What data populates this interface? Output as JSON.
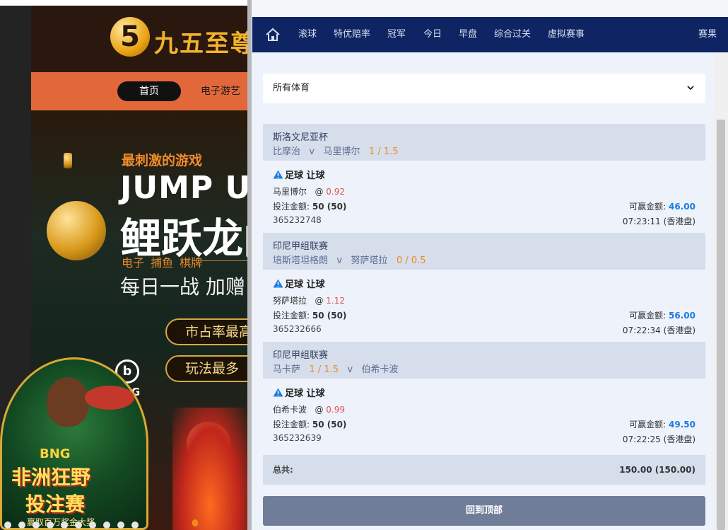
{
  "promo_site": {
    "logo_text": "九五至尊",
    "nav": {
      "home": "首页",
      "games": "电子游艺"
    },
    "banner": {
      "tagline": "最刺激的游戏",
      "headline": "JUMP UP",
      "title": "鲤跃龙门",
      "categories": "电子 捕鱼 棋牌",
      "daily": "每日一战 加赠",
      "pill_1": "市占率最高",
      "pill_2": "玩法最多",
      "brand": "BNG"
    },
    "promo": {
      "brand": "BNG",
      "title_line1": "非洲狂野",
      "title_line2": "投注赛",
      "footer": "赢取百万奖金大奖"
    }
  },
  "betting_panel": {
    "nav": {
      "items": [
        "滚球",
        "特优赔率",
        "冠军",
        "今日",
        "早盘",
        "综合过关",
        "虚拟赛事"
      ],
      "right": "赛果"
    },
    "sport_filter": {
      "label": "所有体育"
    },
    "bets": [
      {
        "league": "斯洛文尼亚杯",
        "home": "比摩治",
        "vs": "v",
        "away": "马里博尔",
        "handicap": "1 / 1.5",
        "handicap_side": "away",
        "bet_type": "足球 让球",
        "pick": "马里博尔",
        "at": "@",
        "odds": "0.92",
        "stake_label": "投注金额:",
        "stake": "50 (50)",
        "win_label": "可赢金额:",
        "win": "46.00",
        "id": "365232748",
        "time": "07:23:11 (香港盘)"
      },
      {
        "league": "印尼甲组联赛",
        "home": "培斯塔坦格朗",
        "vs": "v",
        "away": "努萨塔拉",
        "handicap": "0 / 0.5",
        "handicap_side": "away",
        "bet_type": "足球 让球",
        "pick": "努萨塔拉",
        "at": "@",
        "odds": "1.12",
        "stake_label": "投注金额:",
        "stake": "50 (50)",
        "win_label": "可赢金额:",
        "win": "56.00",
        "id": "365232666",
        "time": "07:22:34 (香港盘)"
      },
      {
        "league": "印尼甲组联赛",
        "home": "马卡萨",
        "vs": "v",
        "away": "伯希卡波",
        "handicap": "1 / 1.5",
        "handicap_side": "home",
        "bet_type": "足球 让球",
        "pick": "伯希卡波",
        "at": "@",
        "odds": "0.99",
        "stake_label": "投注金额:",
        "stake": "50 (50)",
        "win_label": "可赢金额:",
        "win": "49.50",
        "id": "365232639",
        "time": "07:22:25 (香港盘)"
      }
    ],
    "total": {
      "label": "总共:",
      "value": "150.00 (150.00)"
    },
    "back_to_top": "回到顶部"
  },
  "colors": {
    "nav_bg": "#0f2463",
    "handicap": "#f08a1c",
    "odds": "#e24f4f",
    "win_amount": "#1a7ce0",
    "bet_header_bg": "#d6deec",
    "back_button_bg": "#707d99",
    "promo_nav_bg": "#e2683a"
  },
  "icons": {
    "home": "home-icon",
    "chevron": "chevron-down-icon",
    "warning": "warning-icon"
  }
}
